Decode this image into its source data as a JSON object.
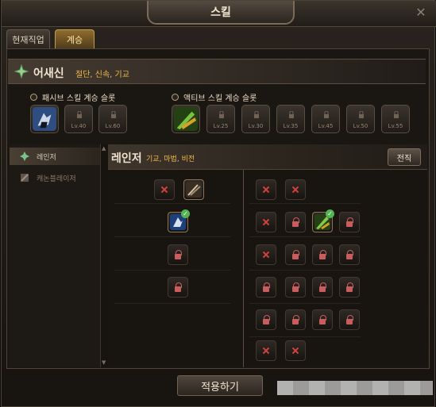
{
  "window": {
    "title": "스킬",
    "close_icon": "close-icon"
  },
  "tabs": [
    {
      "label": "현재직업",
      "active": false
    },
    {
      "label": "계승",
      "active": true
    }
  ],
  "class_header": {
    "name": "어새신",
    "tags": "절단, 신속, 기교",
    "icon": "class-emblem-icon"
  },
  "passive": {
    "label": "패시브 스킬 계승 슬롯",
    "slots": [
      {
        "type": "skill",
        "icon": "passive-skill-icon"
      },
      {
        "type": "locked",
        "level": "Lv.40",
        "icon": "lock-icon"
      },
      {
        "type": "locked",
        "level": "Lv.60",
        "icon": "lock-icon"
      }
    ]
  },
  "active": {
    "label": "액티브 스킬 계승 슬롯",
    "slots": [
      {
        "type": "skill",
        "icon": "active-skill-icon"
      },
      {
        "type": "locked",
        "level": "Lv.25",
        "icon": "lock-icon"
      },
      {
        "type": "locked",
        "level": "Lv.30",
        "icon": "lock-icon"
      },
      {
        "type": "locked",
        "level": "Lv.35",
        "icon": "lock-icon"
      },
      {
        "type": "locked",
        "level": "Lv.45",
        "icon": "lock-icon"
      },
      {
        "type": "locked",
        "level": "Lv.50",
        "icon": "lock-icon"
      },
      {
        "type": "locked",
        "level": "Lv.55",
        "icon": "lock-icon"
      }
    ]
  },
  "sidebar": {
    "items": [
      {
        "label": "레인저",
        "active": true,
        "icon": "ranger-icon"
      },
      {
        "label": "캐논블레이저",
        "active": false,
        "icon": "cannon-icon"
      }
    ]
  },
  "content": {
    "title": "레인저",
    "tags": "기교, 마법, 비전",
    "transfer_button": "전직",
    "left_rows": [
      [
        "x",
        "skill"
      ],
      [
        "skill-check"
      ],
      [
        "lock"
      ],
      [
        "lock"
      ]
    ],
    "right_rows": [
      [
        "x",
        "x"
      ],
      [
        "x",
        "lock",
        "skill-check",
        "lock"
      ],
      [
        "x",
        "lock",
        "lock",
        "lock"
      ],
      [
        "lock",
        "lock",
        "lock",
        "lock"
      ],
      [
        "lock",
        "lock",
        "lock",
        "lock"
      ],
      [
        "x",
        "x"
      ]
    ]
  },
  "apply_button": "적용하기",
  "colors": {
    "accent_orange": "#f0b84b",
    "lock_red": "#c95c5c",
    "x_red": "#d5413d",
    "check_green": "#54b454"
  }
}
